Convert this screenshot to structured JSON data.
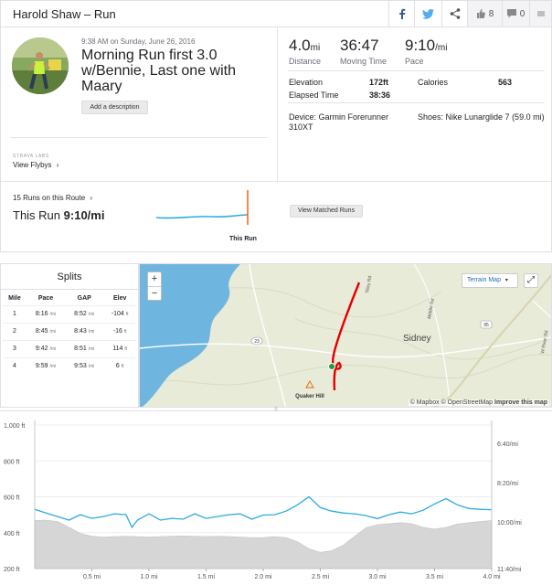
{
  "header": {
    "title": "Harold Shaw – Run",
    "kudos_count": "8",
    "comment_count": "0"
  },
  "activity": {
    "timestamp": "9:38 AM on Sunday, June 26, 2016",
    "name": "Morning Run first 3.0 w/Bennie, Last one with Maary",
    "add_description": "Add a description",
    "labs_label": "STRAVA LABS",
    "flybys_label": "View Flybys"
  },
  "stats": {
    "distance_value": "4.0",
    "distance_unit": "mi",
    "distance_label": "Distance",
    "moving_time_value": "36:47",
    "moving_time_label": "Moving Time",
    "pace_value": "9:10",
    "pace_unit": "/mi",
    "pace_label": "Pace",
    "elevation_label": "Elevation",
    "elevation_value": "172ft",
    "calories_label": "Calories",
    "calories_value": "563",
    "elapsed_label": "Elapsed Time",
    "elapsed_value": "38:36",
    "device_text": "Device: Garmin Forerunner 310XT",
    "shoes_text": "Shoes: Nike Lunarglide 7 (59.0 mi)"
  },
  "route": {
    "count_label": "15 Runs on this Route",
    "this_run_prefix": "This Run",
    "this_run_pace": "9:10/mi",
    "marker_label": "This Run",
    "matched_button": "View Matched Runs"
  },
  "splits": {
    "title": "Splits",
    "columns": [
      "Mile",
      "Pace",
      "GAP",
      "Elev"
    ],
    "rows": [
      {
        "mile": "1",
        "pace": "8:16",
        "gap": "8:52",
        "elev": "-104"
      },
      {
        "mile": "2",
        "pace": "8:45",
        "gap": "8:43",
        "elev": "-16"
      },
      {
        "mile": "3",
        "pace": "9:42",
        "gap": "8:51",
        "elev": "114"
      },
      {
        "mile": "4",
        "pace": "9:59",
        "gap": "9:53",
        "elev": "6"
      }
    ],
    "pace_unit": "/mi",
    "elev_unit": "ft"
  },
  "map": {
    "zoom_in": "+",
    "zoom_out": "−",
    "layer_select": "Terrain Map",
    "labels": [
      "Sidney",
      "Quaker Hill",
      "Middle Rd",
      "Tilley Rd",
      "W River Rd"
    ],
    "road_shields": [
      "23",
      "95"
    ],
    "attribution_mapbox": "© Mapbox",
    "attribution_osm": "© OpenStreetMap",
    "attribution_improve": "Improve this map"
  },
  "chart_data": {
    "type": "line",
    "left_axis_ticks": [
      "1,000 ft",
      "800 ft",
      "600 ft",
      "400 ft",
      "200 ft"
    ],
    "right_axis_ticks": [
      "6:40/mi",
      "8:20/mi",
      "10:00/mi",
      "11:40/mi"
    ],
    "x_ticks": [
      "0.5 mi",
      "1.0 mi",
      "1.5 mi",
      "2.0 mi",
      "2.5 mi",
      "3.0 mi",
      "3.5 mi",
      "4.0 mi"
    ],
    "xlim": [
      0,
      4.0
    ],
    "elevation_ylim": [
      200,
      1000
    ],
    "pace_ylim_sec_per_mi": [
      400,
      700
    ],
    "series": [
      {
        "type": "area",
        "x": [
          0,
          0.1,
          0.2,
          0.3,
          0.4,
          0.5,
          0.6,
          0.7,
          0.8,
          0.9,
          1.0,
          1.1,
          1.2,
          1.3,
          1.4,
          1.5,
          1.6,
          1.7,
          1.8,
          1.9,
          2.0,
          2.1,
          2.2,
          2.3,
          2.4,
          2.5,
          2.6,
          2.7,
          2.8,
          2.9,
          3.0,
          3.1,
          3.2,
          3.3,
          3.4,
          3.5,
          3.6,
          3.7,
          3.8,
          3.9,
          4.0
        ],
        "values": [
          468,
          470,
          462,
          430,
          396,
          380,
          376,
          378,
          380,
          378,
          376,
          378,
          380,
          382,
          380,
          378,
          380,
          378,
          376,
          372,
          372,
          378,
          372,
          350,
          310,
          290,
          300,
          330,
          380,
          428,
          444,
          450,
          456,
          450,
          430,
          420,
          430,
          448,
          456,
          462,
          468
        ]
      },
      {
        "type": "line",
        "x": [
          0,
          0.1,
          0.2,
          0.3,
          0.4,
          0.5,
          0.6,
          0.7,
          0.8,
          0.85,
          0.9,
          1.0,
          1.1,
          1.2,
          1.3,
          1.4,
          1.5,
          1.6,
          1.7,
          1.8,
          1.9,
          2.0,
          2.1,
          2.2,
          2.3,
          2.4,
          2.5,
          2.6,
          2.7,
          2.8,
          2.9,
          3.0,
          3.1,
          3.2,
          3.3,
          3.4,
          3.5,
          3.6,
          3.7,
          3.8,
          3.9,
          4.0
        ],
        "values": [
          530,
          510,
          490,
          470,
          500,
          480,
          490,
          505,
          500,
          430,
          470,
          505,
          470,
          480,
          475,
          505,
          480,
          490,
          500,
          505,
          475,
          498,
          500,
          520,
          555,
          600,
          540,
          520,
          510,
          505,
          495,
          478,
          500,
          515,
          505,
          525,
          560,
          590,
          555,
          535,
          530,
          528
        ]
      }
    ]
  }
}
